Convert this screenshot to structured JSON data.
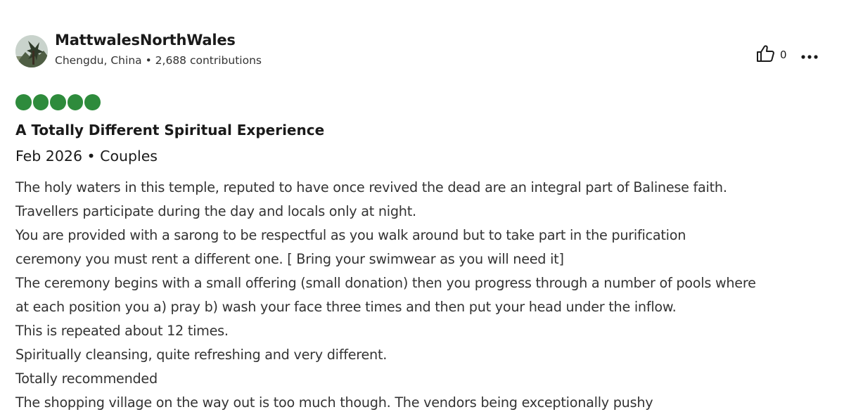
{
  "review": {
    "user": {
      "name": "MattwalesNorthWales",
      "location": "Chengdu, China",
      "separator": "•",
      "contributions": "2,688 contributions"
    },
    "actions": {
      "helpful_icon": "thumbs-up-icon",
      "helpful_count": "0",
      "more_icon": "more-options-icon"
    },
    "rating": {
      "value": 5,
      "max": 5,
      "color": "#2e8b3c"
    },
    "title": "A Totally Different Spiritual Experience",
    "date": "Feb 2026",
    "trip_type": "Couples",
    "body_lines": [
      "The holy waters in this temple, reputed to have once revived the dead are an integral part of Balinese faith.",
      "Travellers participate during the day and locals only at night.",
      "You are provided with a sarong to be respectful as you walk around but to take part in the purification",
      "ceremony you must rent a different one. [ Bring your swimwear as you will need it]",
      "The ceremony begins with a small offering (small donation) then you progress through a number of pools where",
      "at each position you a) pray b) wash your face three times and then put your head under the inflow.",
      "This is repeated about 12 times.",
      "Spiritually cleansing, quite refreshing and very different.",
      "Totally recommended",
      "The shopping village on the way out is too much though. The vendors being exceptionally pushy"
    ]
  }
}
